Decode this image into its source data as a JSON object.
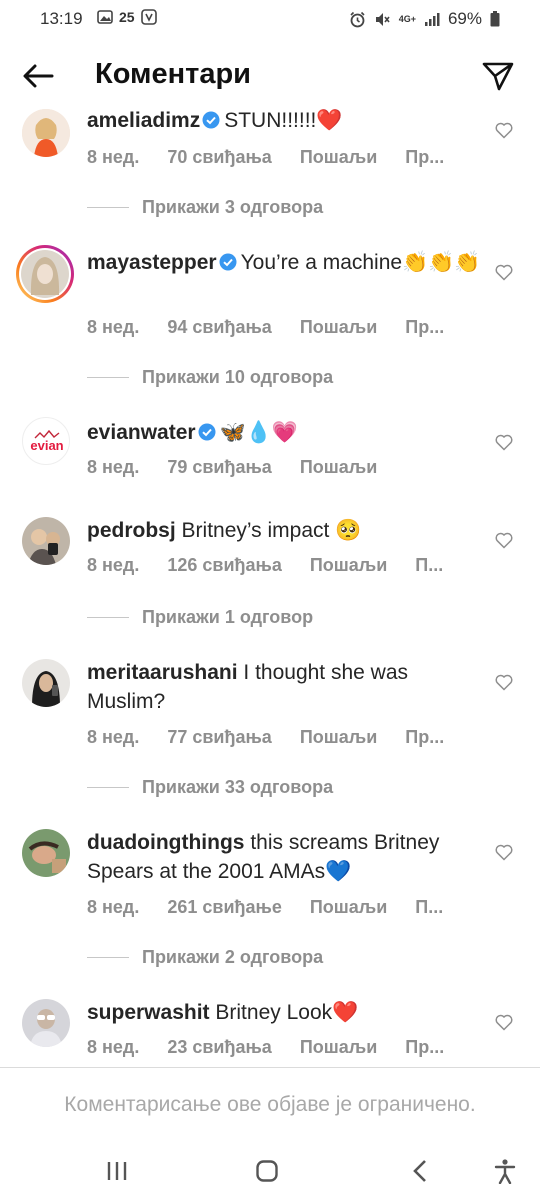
{
  "status_bar": {
    "time": "13:19",
    "notif_count": "25",
    "network": "4G+",
    "battery": "69%"
  },
  "header": {
    "title": "Коментари"
  },
  "comments": [
    {
      "username": "ameliadimz",
      "verified": true,
      "text": "STUN!!!!!!❤️",
      "time": "8 нед.",
      "likes": "70 свиђања",
      "send": "Пошаљи",
      "more": "Пр...",
      "replies": "Прикажи 3 одговора",
      "avatar_color": "#f1e0d3"
    },
    {
      "username": "mayastepper",
      "verified": true,
      "text": "You’re a machine👏👏👏",
      "time": "8 нед.",
      "likes": "94 свиђања",
      "send": "Пошаљи",
      "more": "Пр...",
      "replies": "Прикажи 10 одговора",
      "avatar_color": "#d9d4cc"
    },
    {
      "username": "evianwater",
      "verified": true,
      "text": "🦋💧💗",
      "time": "8 нед.",
      "likes": "79 свиђања",
      "send": "Пошаљи",
      "more": "",
      "replies": "",
      "avatar_color": "#ffffff"
    },
    {
      "username": "pedrobsj",
      "verified": false,
      "text": "Britney’s impact 🥺",
      "time": "8 нед.",
      "likes": "126 свиђања",
      "send": "Пошаљи",
      "more": "П...",
      "replies": "Прикажи 1 одговор",
      "avatar_color": "#8a7f74"
    },
    {
      "username": "meritaarushani",
      "verified": false,
      "text": "I thought she was Muslim?",
      "time": "8 нед.",
      "likes": "77 свиђања",
      "send": "Пошаљи",
      "more": "Пр...",
      "replies": "Прикажи 33 одговора",
      "avatar_color": "#4a4a4a"
    },
    {
      "username": "duadoingthings",
      "verified": false,
      "text": "this screams Britney Spears at the 2001 AMAs💙",
      "time": "8 нед.",
      "likes": "261 свиђање",
      "send": "Пошаљи",
      "more": "П...",
      "replies": "Прикажи 2 одговора",
      "avatar_color": "#6b8f6a"
    },
    {
      "username": "superwashit",
      "verified": false,
      "text": "Britney Look❤️",
      "time": "8 нед.",
      "likes": "23 свиђања",
      "send": "Пошаљи",
      "more": "Пр...",
      "replies": "",
      "avatar_color": "#b8b8bd"
    }
  ],
  "footer": {
    "notice": "Коментарисање ове објаве је ограничено."
  },
  "icons": {
    "back": "arrow-left-icon",
    "send": "paper-plane-icon",
    "like": "heart-icon",
    "verified": "verified-badge-icon",
    "nav_recents": "recents-icon",
    "nav_home": "home-icon",
    "nav_back": "chevron-left-icon",
    "nav_accessibility": "accessibility-icon"
  },
  "colors": {
    "verified_blue": "#3897f0",
    "meta_gray": "#8e8e8e",
    "story_ring": "#e1306c"
  }
}
